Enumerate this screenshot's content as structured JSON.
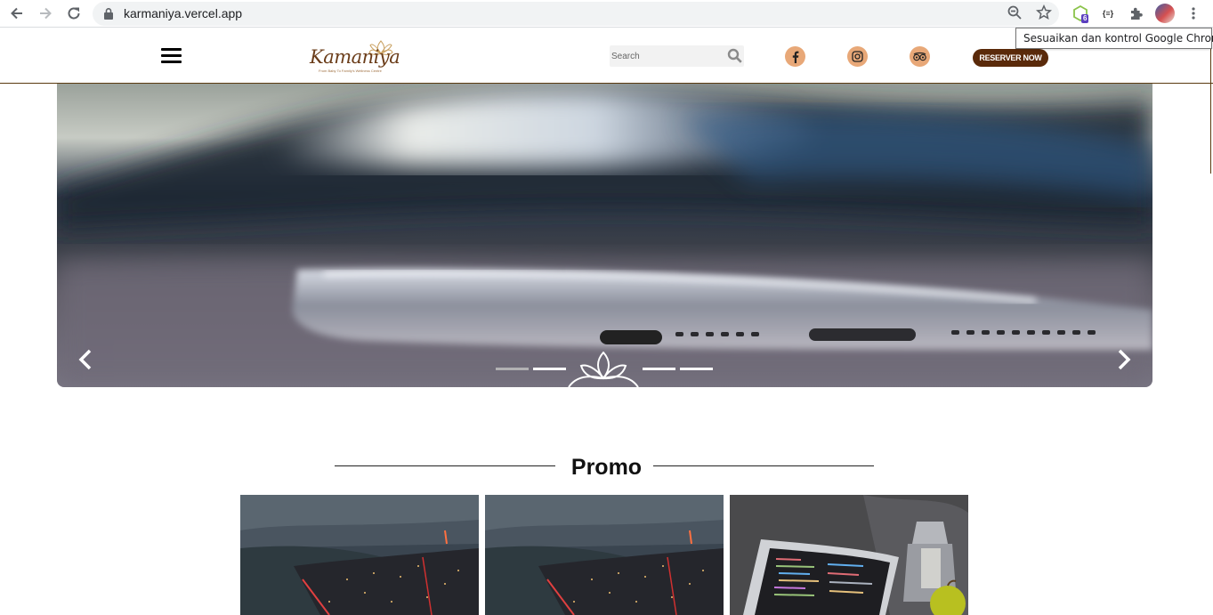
{
  "browser": {
    "url": "karmaniya.vercel.app",
    "extension_badge": "6",
    "ext2_label": "{≡}",
    "tooltip": "Sesuaikan dan kontrol Google Chrome"
  },
  "header": {
    "logo_text": "Kamaniya",
    "logo_tagline": "From Baby To Family's Wellness Centre",
    "search_placeholder": "Search",
    "reserve_label": "RESERVER NOW",
    "social": [
      "facebook",
      "instagram",
      "tripadvisor"
    ]
  },
  "hero": {
    "slide_count": 4,
    "active_slide": 1
  },
  "promo": {
    "title": "Promo",
    "cards": [
      "city-night",
      "city-night",
      "laptop-code"
    ]
  },
  "colors": {
    "brand_brown": "#5a2a0a",
    "social_bg": "#e8a878",
    "header_border": "#5a3a10"
  }
}
